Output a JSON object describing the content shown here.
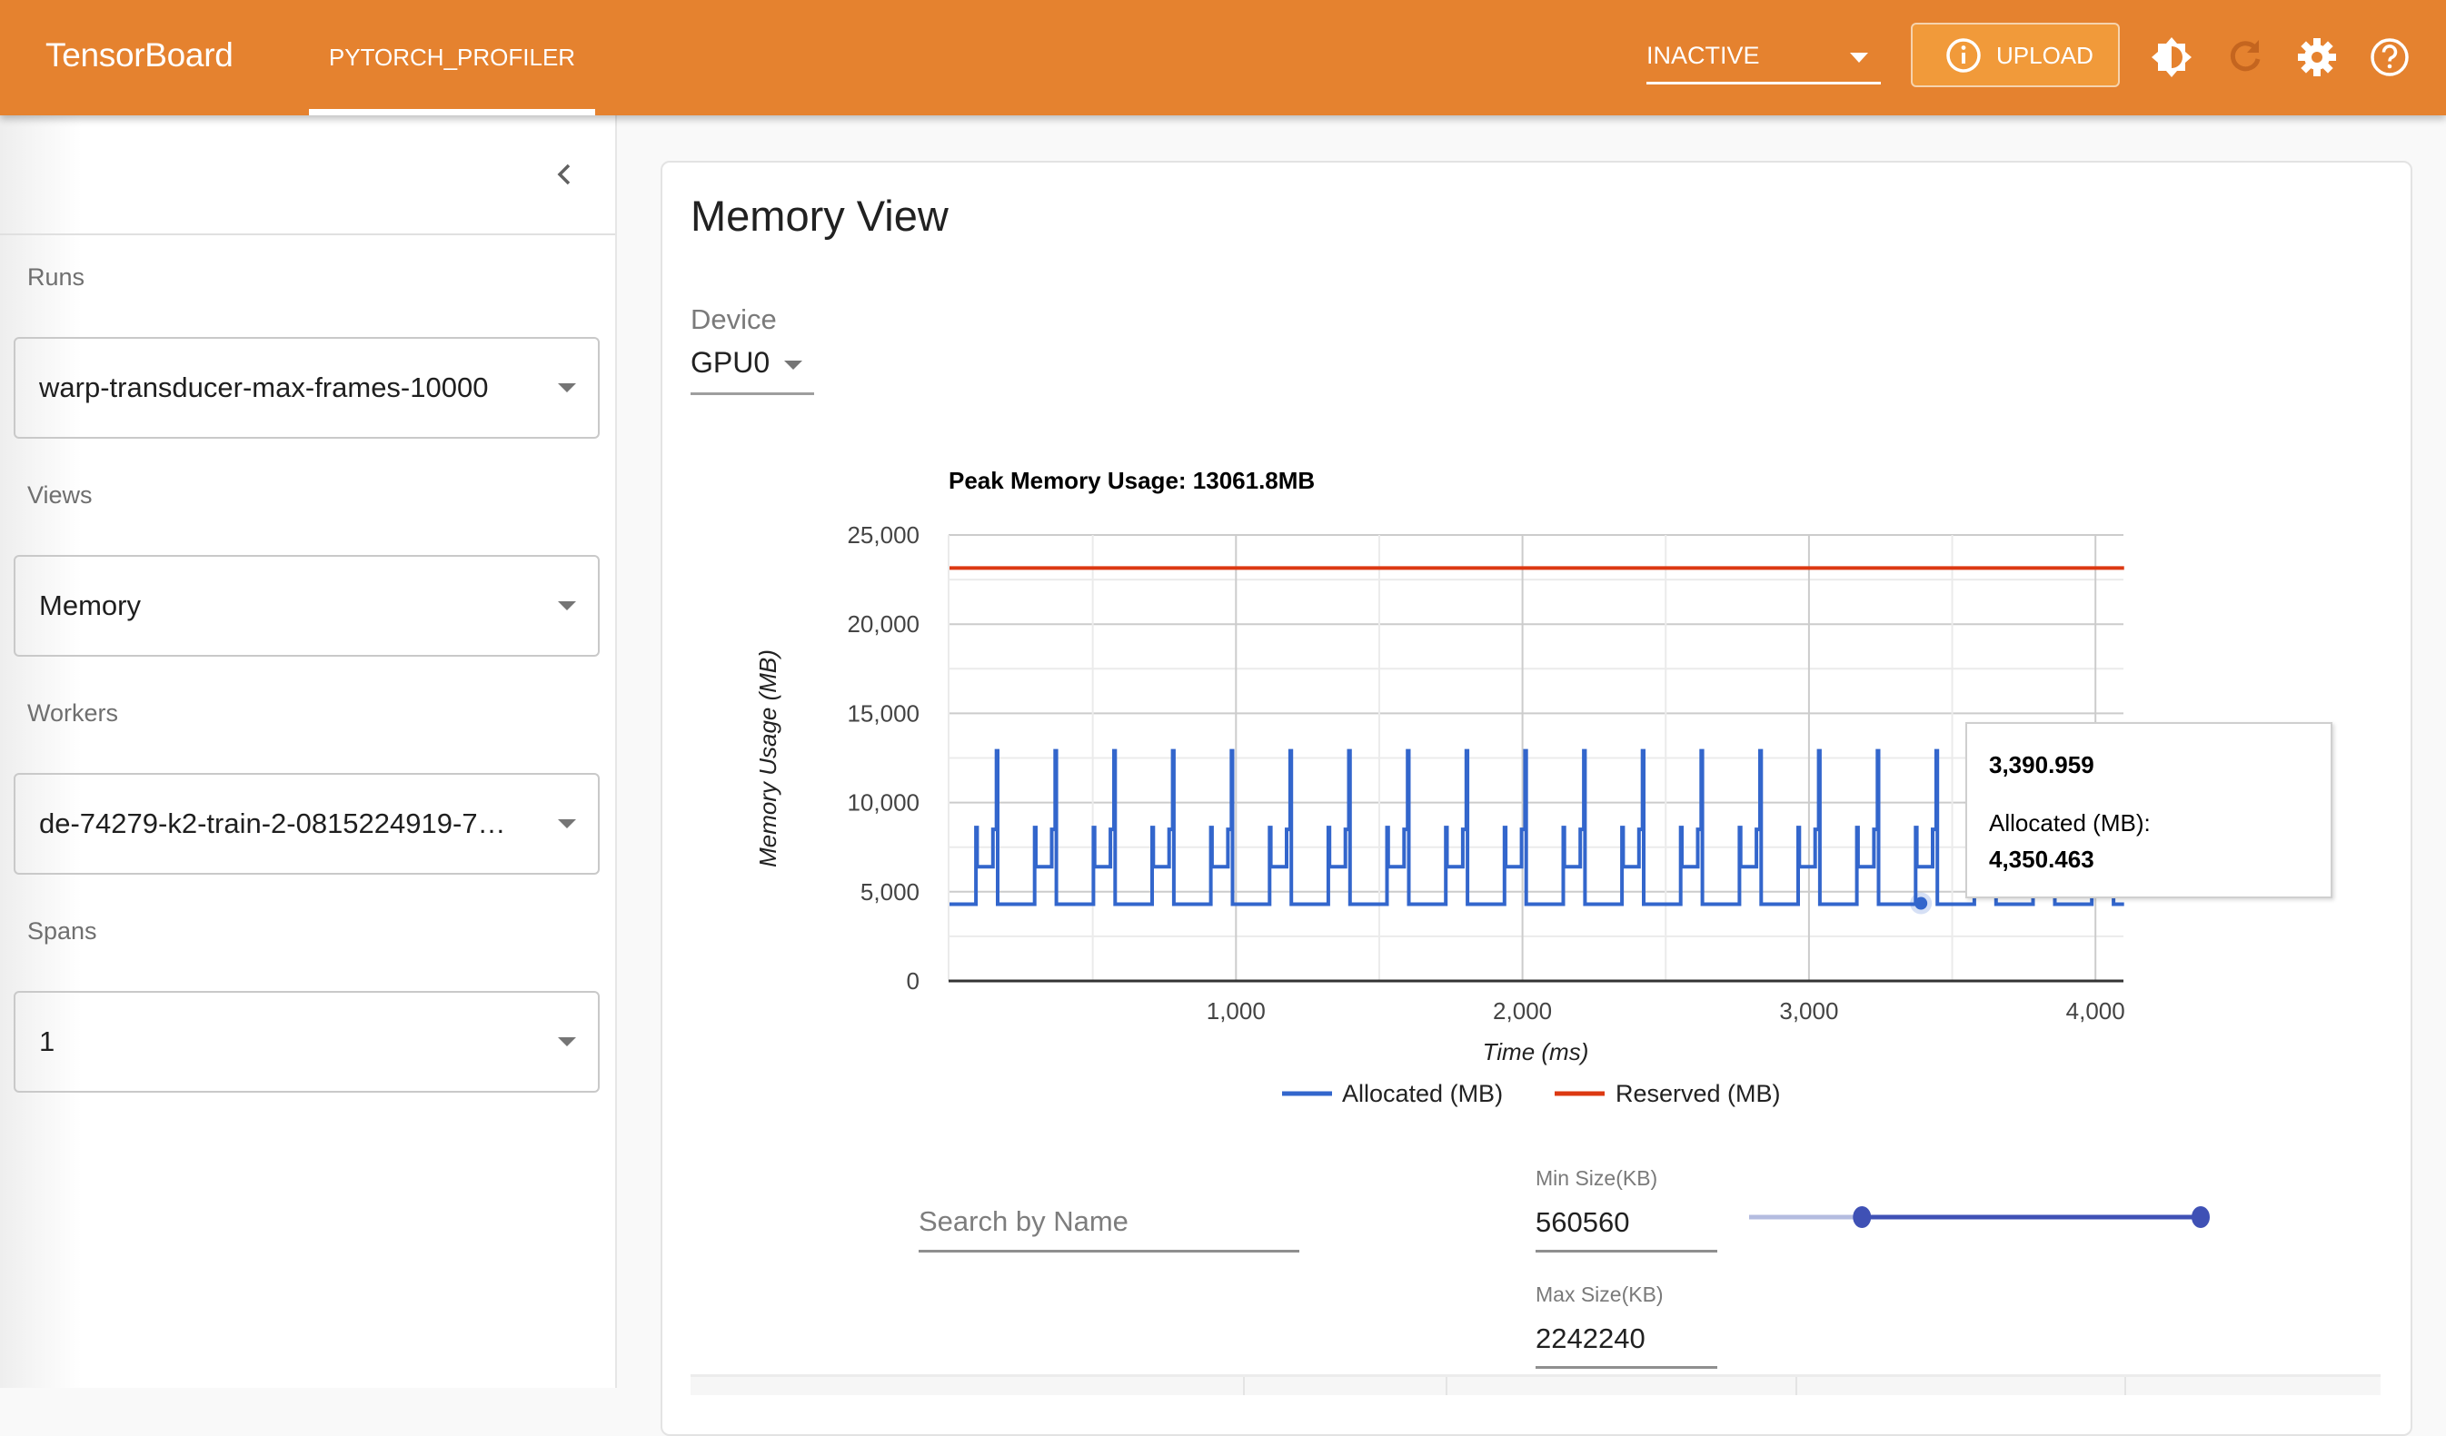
{
  "header": {
    "brand": "TensorBoard",
    "tabs": [
      {
        "label": "PYTORCH_PROFILER",
        "active": true
      }
    ],
    "status_select": {
      "value": "INACTIVE"
    },
    "upload_button": {
      "label": "UPLOAD",
      "icon": "info-icon"
    },
    "icons": [
      "brightness-icon",
      "refresh-icon",
      "settings-icon",
      "help-icon"
    ],
    "color": "#E5822F"
  },
  "sidebar": {
    "collapse_icon": "chevron-left-icon",
    "fields": [
      {
        "label": "Runs",
        "value": "warp-transducer-max-frames-10000"
      },
      {
        "label": "Views",
        "value": "Memory"
      },
      {
        "label": "Workers",
        "value": "de-74279-k2-train-2-0815224919-7…"
      },
      {
        "label": "Spans",
        "value": "1"
      }
    ]
  },
  "main": {
    "title": "Memory View",
    "device": {
      "label": "Device",
      "value": "GPU0"
    },
    "tooltip": {
      "x_value": "3,390.959",
      "series_label": "Allocated (MB):",
      "y_value": "4,350.463"
    },
    "filters": {
      "search_placeholder": "Search by Name",
      "search_value": "",
      "min_size": {
        "label": "Min Size(KB)",
        "value": "560560"
      },
      "max_size": {
        "label": "Max Size(KB)",
        "value": "2242240"
      },
      "slider": {
        "low_fraction": 0.25,
        "high_fraction": 1.0
      }
    }
  },
  "chart_data": {
    "type": "line",
    "title": "Peak Memory Usage: 13061.8MB",
    "xlabel": "Time (ms)",
    "ylabel": "Memory Usage (MB)",
    "xlim": [
      0,
      4100
    ],
    "ylim": [
      0,
      25000
    ],
    "x_ticks": [
      1000,
      2000,
      3000,
      4000
    ],
    "x_tick_labels": [
      "1,000",
      "2,000",
      "3,000",
      "4,000"
    ],
    "y_ticks": [
      0,
      5000,
      10000,
      15000,
      20000,
      25000
    ],
    "y_tick_labels": [
      "0",
      "5,000",
      "10,000",
      "15,000",
      "20,000",
      "25,000"
    ],
    "grid": true,
    "legend": {
      "position": "bottom",
      "entries": [
        "Allocated (MB)",
        "Reserved (MB)"
      ]
    },
    "series": [
      {
        "name": "Allocated (MB)",
        "color": "#3366CC",
        "step": true,
        "cycle": {
          "start_ms": 0,
          "period_ms": 205,
          "count": 20,
          "pattern": [
            {
              "t": 0,
              "v": 4300
            },
            {
              "t": 0.45,
              "v": 8600
            },
            {
              "t": 0.47,
              "v": 6400
            },
            {
              "t": 0.74,
              "v": 8500
            },
            {
              "t": 0.8,
              "v": 12900
            },
            {
              "t": 0.82,
              "v": 4300
            }
          ]
        },
        "highlight_point": {
          "x": 3390.959,
          "y": 4350.463
        }
      },
      {
        "name": "Reserved (MB)",
        "color": "#DC3912",
        "x": [
          0,
          4100
        ],
        "y": [
          23150,
          23150
        ]
      }
    ]
  }
}
